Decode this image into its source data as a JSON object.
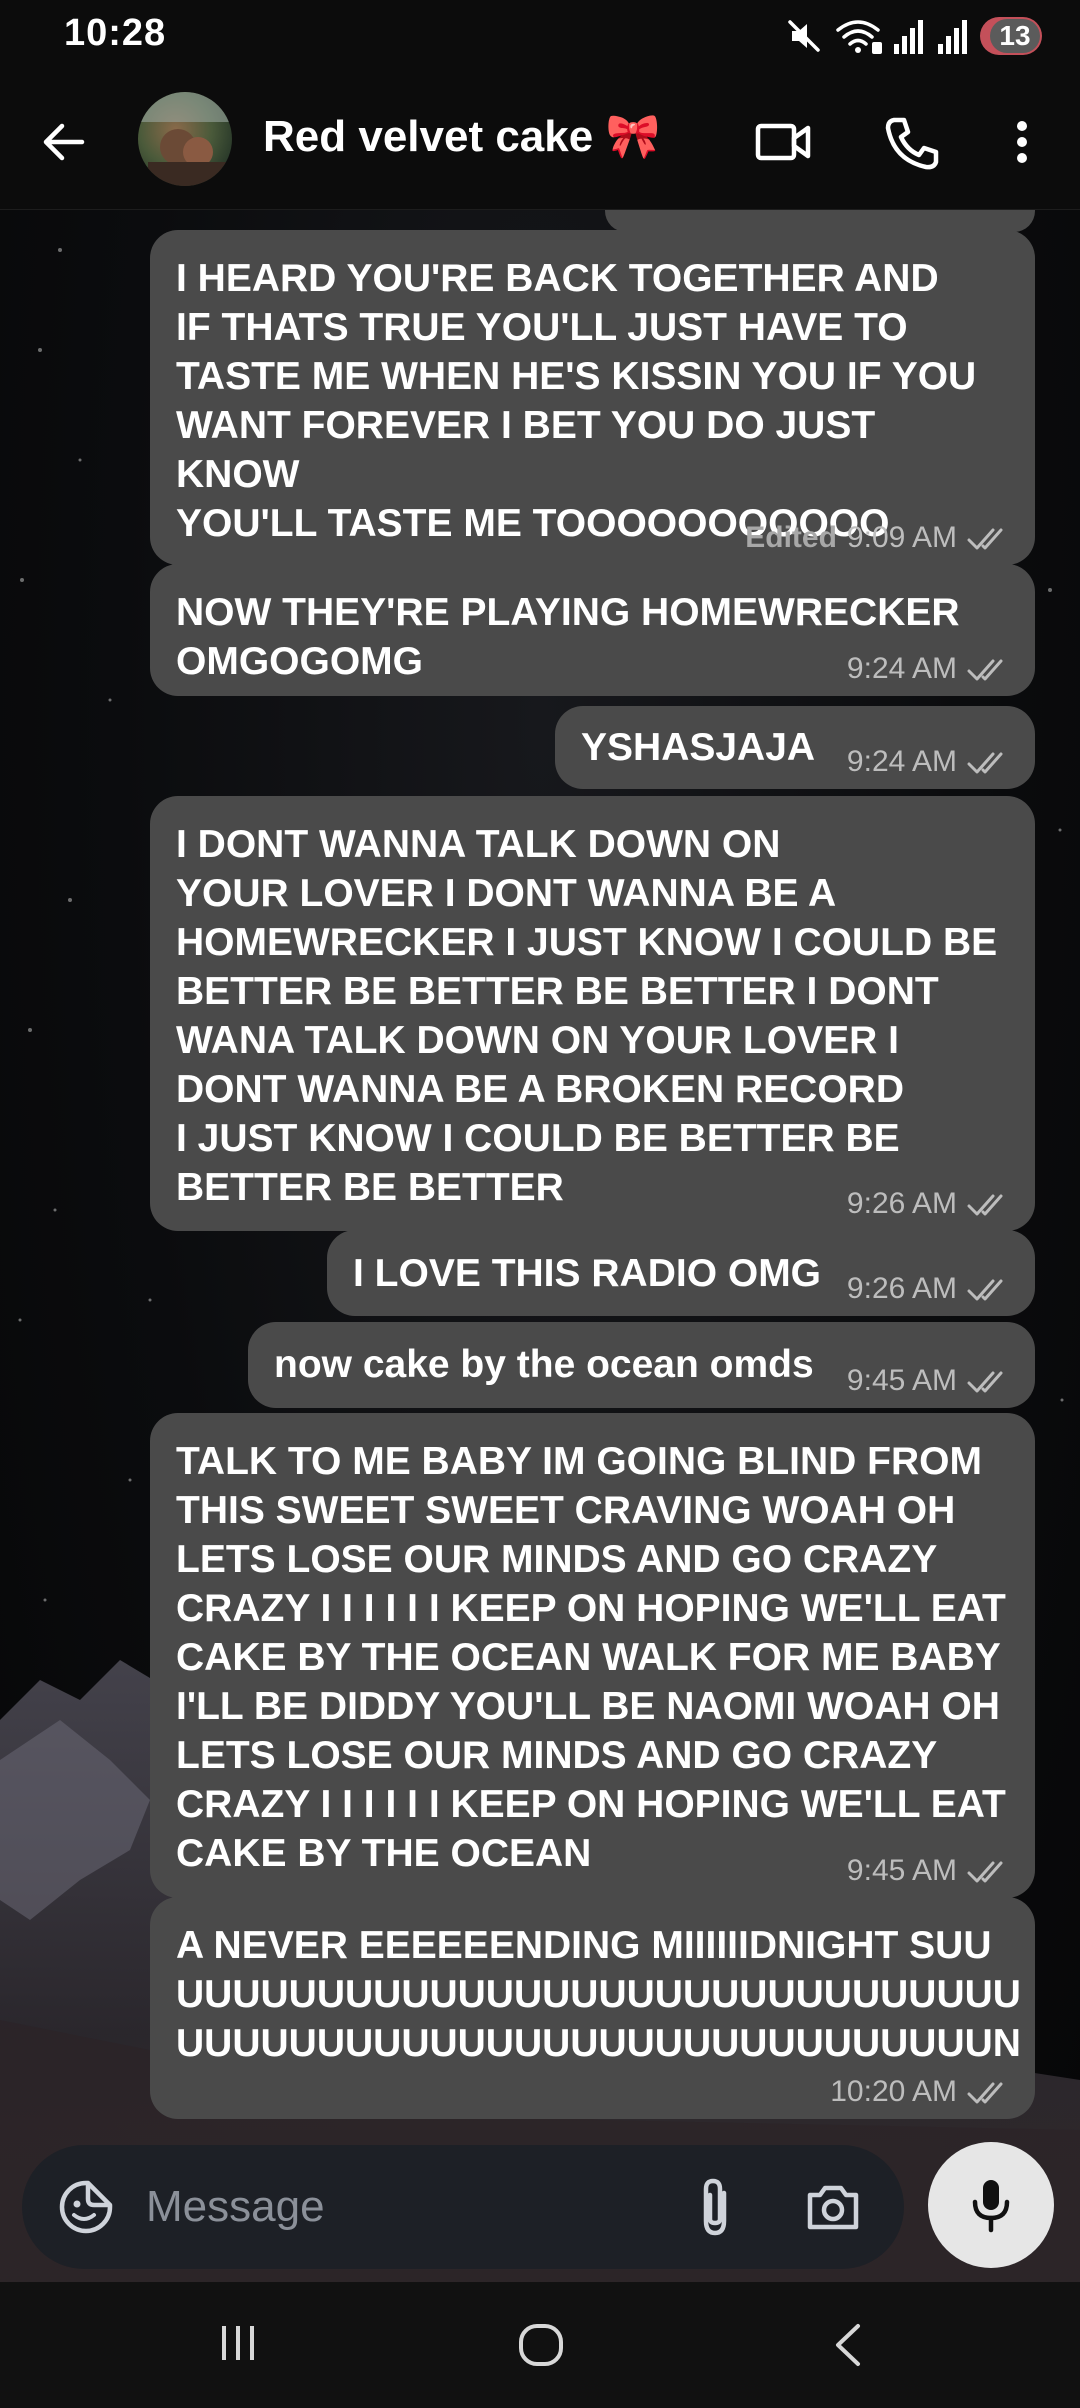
{
  "status_bar": {
    "time": "10:28",
    "notification_count": "13",
    "icons": [
      "mute-icon",
      "wifi-calling-icon",
      "signal-icon",
      "signal-icon",
      "notification-badge"
    ]
  },
  "header": {
    "contact_name": "Red velvet cake 🎀",
    "icons": [
      "back-arrow-icon",
      "video-call-icon",
      "phone-icon",
      "more-vert-icon"
    ]
  },
  "messages": [
    {
      "text": "I HEARD YOU'RE BACK TOGETHER AND\nIF THATS TRUE YOU'LL JUST HAVE TO\nTASTE ME WHEN HE'S KISSIN YOU IF YOU\nWANT FOREVER I BET YOU DO JUST KNOW\nYOU'LL TASTE ME TOOOOOOOOOOO",
      "edited": "Edited",
      "time": "9:09 AM"
    },
    {
      "text": "NOW THEY'RE PLAYING HOMEWRECKER\nOMGOGOMG",
      "time": "9:24 AM"
    },
    {
      "text": "YSHASJAJA",
      "time": "9:24 AM"
    },
    {
      "text": "I DONT WANNA TALK DOWN ON\nYOUR LOVER I DONT WANNA BE A\nHOMEWRECKER I JUST KNOW I COULD BE\nBETTER BE BETTER BE BETTER I DONT\nWANA TALK DOWN ON YOUR LOVER I\nDONT WANNA BE A BROKEN RECORD\nI JUST KNOW I COULD BE BETTER BE\nBETTER BE BETTER",
      "time": "9:26 AM"
    },
    {
      "text": "I LOVE THIS RADIO OMG",
      "time": "9:26 AM"
    },
    {
      "text": "now cake by the ocean omds",
      "time": "9:45 AM"
    },
    {
      "text": "TALK TO ME BABY IM GOING BLIND FROM\nTHIS SWEET SWEET CRAVING WOAH OH\nLETS LOSE OUR MINDS AND GO CRAZY\nCRAZY I I I I I I KEEP ON HOPING WE'LL EAT\nCAKE BY THE OCEAN WALK FOR ME BABY\nI'LL BE DIDDY YOU'LL BE NAOMI WOAH OH\nLETS LOSE OUR MINDS AND GO CRAZY\nCRAZY I I I I I I KEEP ON HOPING WE'LL EAT\nCAKE BY THE OCEAN",
      "time": "9:45 AM"
    },
    {
      "text": "A NEVER EEEEEENDING MIIIIIIDNIGHT SUU\nUUUUUUUUUUUUUUUUUUUUUUUUUUUUUU\nUUUUUUUUUUUUUUUUUUUUUUUUUUUUUN",
      "time": "10:20 AM"
    }
  ],
  "composer": {
    "placeholder": "Message",
    "icons": [
      "sticker-icon",
      "attach-icon",
      "camera-icon",
      "microphone-icon"
    ]
  },
  "nav_bar": {
    "icons": [
      "recent-apps-icon",
      "home-icon",
      "back-icon"
    ]
  }
}
